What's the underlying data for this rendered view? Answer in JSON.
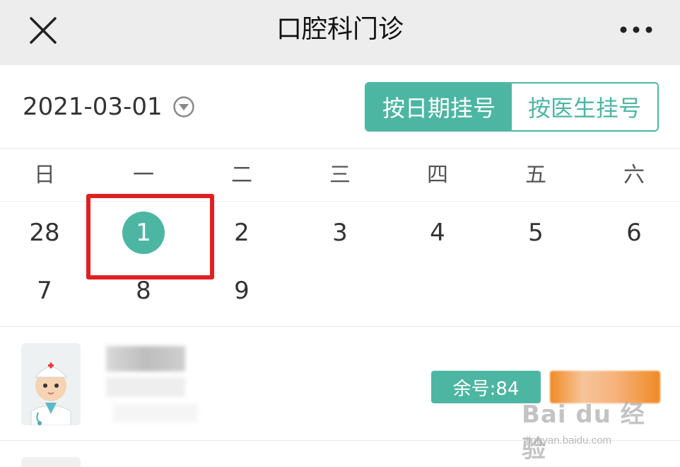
{
  "header": {
    "title": "口腔科门诊",
    "close_icon": "close-icon",
    "more_icon": "more-icon"
  },
  "date_bar": {
    "selected_date": "2021-03-01",
    "caret_icon": "dropdown-circle-icon",
    "tabs": [
      {
        "label": "按日期挂号",
        "active": true
      },
      {
        "label": "按医生挂号",
        "active": false
      }
    ]
  },
  "calendar": {
    "weekdays": [
      "日",
      "一",
      "二",
      "三",
      "四",
      "五",
      "六"
    ],
    "weeks": [
      [
        "28",
        "1",
        "2",
        "3",
        "4",
        "5",
        "6"
      ],
      [
        "7",
        "8",
        "9"
      ]
    ],
    "selected_day": "1"
  },
  "doctors": [
    {
      "avatar_icon": "doctor-avatar-icon",
      "remaining_label": "余号:84"
    }
  ],
  "watermark": {
    "main": "Bai du 经验",
    "sub": "jingyan.baidu.com"
  },
  "colors": {
    "accent": "#4db6a3",
    "highlight": "#e02020",
    "register_button": "#f08a24",
    "header_bg": "#ededed"
  }
}
